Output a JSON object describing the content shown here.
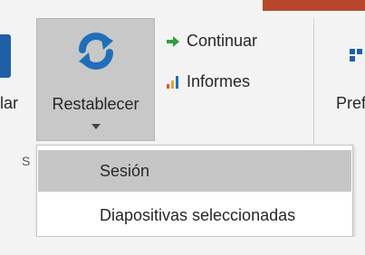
{
  "ribbon": {
    "partial_left_label": "lar",
    "reset_button": {
      "label": "Restablecer",
      "icon": "refresh-icon"
    },
    "commands": [
      {
        "label": "Continuar",
        "icon": "green-arrow-right-icon"
      },
      {
        "label": "Informes",
        "icon": "bar-chart-icon"
      }
    ],
    "partial_right_label": "Prefe",
    "partial_group_label": "S"
  },
  "dropdown": {
    "items": [
      {
        "label": "Sesión",
        "selected": true
      },
      {
        "label": "Diapositivas seleccionadas",
        "selected": false
      }
    ]
  },
  "colors": {
    "accent": "#b7472a",
    "highlight": "#c6c6c6",
    "icon_blue": "#1f6fb8"
  }
}
